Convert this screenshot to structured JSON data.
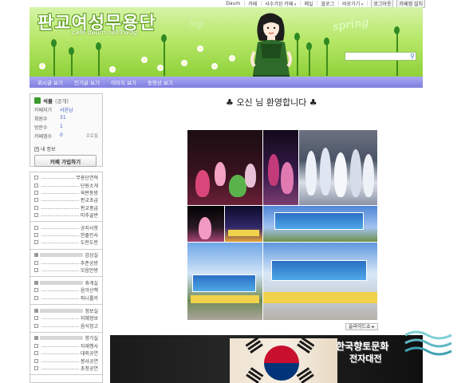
{
  "topbar": {
    "items": [
      "Daum",
      "카페",
      "사수가된 카페",
      "메일",
      "블로그",
      "바로가기",
      "로그아웃",
      "카페앱 설치"
    ]
  },
  "banner": {
    "title": "판교여성무용단",
    "url": "cafe.daum.net/kwdg",
    "deco_word_1": "ing",
    "deco_word_2": "spring",
    "search_placeholder": ""
  },
  "nav": {
    "items": [
      "위시글 보기",
      "인기글 보기",
      "이미지 보기",
      "동영상 보기"
    ]
  },
  "profile": {
    "name": "석물",
    "status": "(공개)",
    "rows": [
      {
        "key": "카페지기",
        "value": "서윤남"
      },
      {
        "key": "회원수",
        "value": "31"
      },
      {
        "key": "방문수",
        "value": "1"
      },
      {
        "key": "카페앱수",
        "value": "0"
      }
    ],
    "more": "프로필",
    "my_info": "내 정보",
    "join_button": "카페 가입하기"
  },
  "menu": {
    "groups": [
      {
        "header": null,
        "items": [
          "무용단연혁",
          "단원소개",
          "육판동방",
          "판교초급",
          "판교중급",
          "미추골반"
        ]
      },
      {
        "header": null,
        "items": [
          "공지사항",
          "한줄인사",
          "도란도란"
        ]
      },
      {
        "header": "감상실",
        "items": [
          "추준공방",
          "모음만방"
        ]
      },
      {
        "header": "휴게실",
        "items": [
          "음악산책",
          "퍼니롤카"
        ]
      },
      {
        "header": "정보실",
        "items": [
          "지혜정보",
          "음식창고"
        ]
      },
      {
        "header": "향기실",
        "items": [
          "자재행사",
          "대외공연",
          "봉사공연",
          "초청공연"
        ]
      }
    ]
  },
  "main": {
    "welcome": "♣ 오신 님 환영합니다 ♣",
    "slideshow_label": "슬라이드쇼 ▸"
  },
  "watermark": {
    "line1": "한국향토문화",
    "line2": "전자대전"
  },
  "colors": {
    "nav": "#8b8be6",
    "banner_green": "#9fdb4a",
    "link_blue": "#3d5fc4"
  }
}
